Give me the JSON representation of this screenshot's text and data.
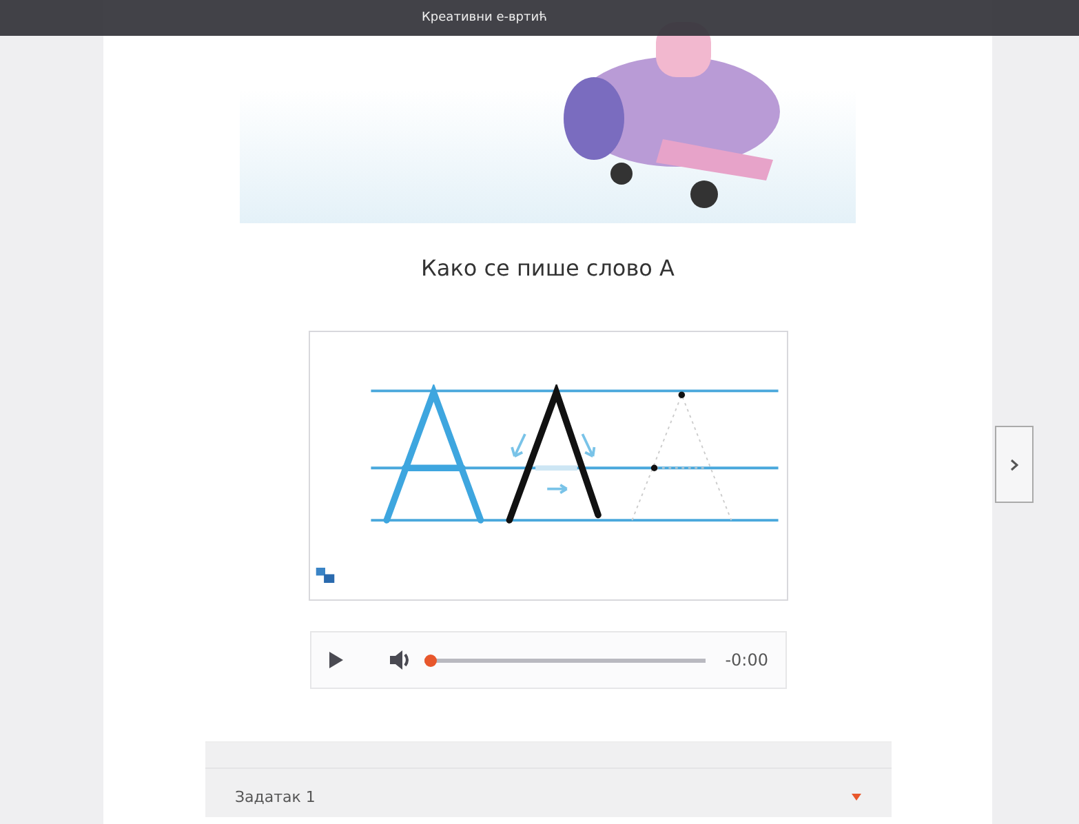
{
  "top_bar": {
    "title": "Креативни е-вртић"
  },
  "heading": "Како се пише слово А",
  "audio": {
    "time": "-0:00",
    "level": 0
  },
  "accordion": [
    {
      "title": "Задатак 1",
      "expanded": false
    }
  ]
}
